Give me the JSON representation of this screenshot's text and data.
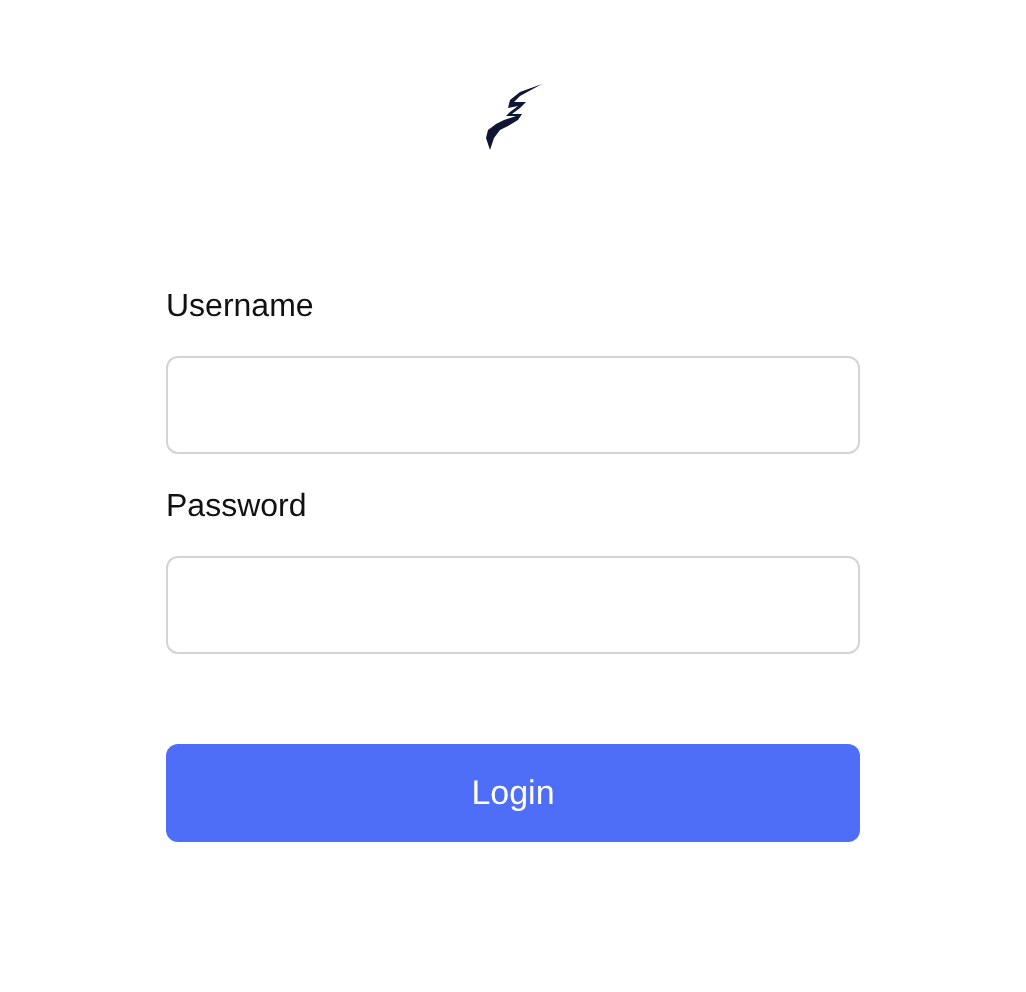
{
  "fields": [
    {
      "label": "Username"
    },
    {
      "label": "Password"
    }
  ],
  "button": "Login"
}
